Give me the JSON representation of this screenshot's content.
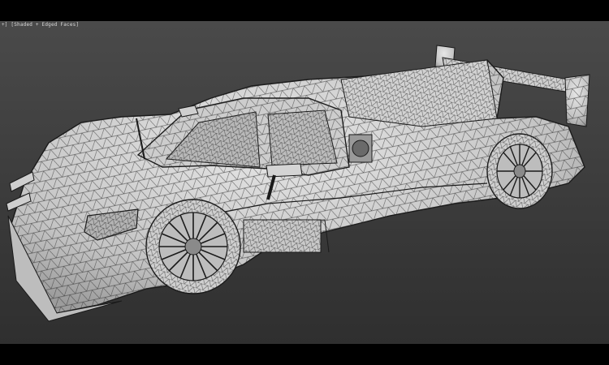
{
  "viewport": {
    "label": "+] [Shaded + Edged Faces]",
    "background_top": "#4a4a4a",
    "background_bottom": "#2f2f2f",
    "wire_color": "#1a1a1a",
    "surface_color": "#d6d6d6"
  }
}
